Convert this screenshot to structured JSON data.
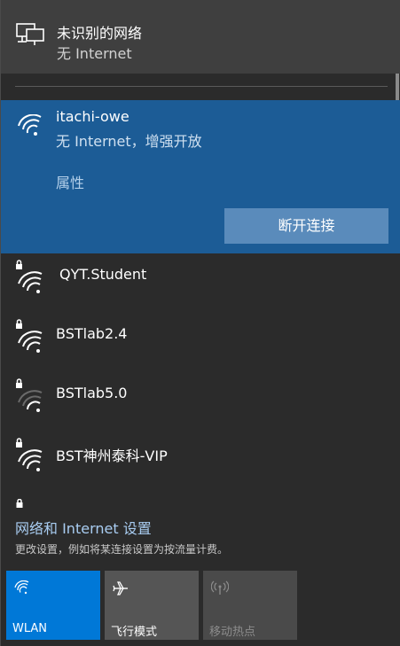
{
  "wired_network": {
    "name": "未识别的网络",
    "status": "无 Internet",
    "icon": "wired-network-icon"
  },
  "connected_network": {
    "ssid": "itachi-owe",
    "status": "无 Internet，增强开放",
    "properties_label": "属性",
    "disconnect_label": "断开连接",
    "icon": "wifi-signal-icon"
  },
  "networks": [
    {
      "ssid": "QYT.Student",
      "secured": true,
      "icon": "wifi-secured-icon"
    },
    {
      "ssid": "BSTlab2.4",
      "secured": true,
      "icon": "wifi-secured-icon"
    },
    {
      "ssid": "BSTlab5.0",
      "secured": true,
      "icon": "wifi-secured-icon"
    },
    {
      "ssid": "BST神州泰科-VIP",
      "secured": true,
      "icon": "wifi-secured-icon"
    }
  ],
  "settings": {
    "link": "网络和 Internet 设置",
    "description": "更改设置，例如将某连接设置为按流量计费。"
  },
  "quick_actions": [
    {
      "label": "WLAN",
      "active": true,
      "icon": "wifi-icon"
    },
    {
      "label": "飞行模式",
      "active": false,
      "icon": "airplane-icon"
    },
    {
      "label": "移动热点",
      "active": false,
      "disabled": true,
      "icon": "hotspot-icon"
    }
  ],
  "colors": {
    "panel_bg": "#2b2b2b",
    "selected_bg": "#1c5c96",
    "accent": "#0078d7",
    "link": "#a9cdf2"
  }
}
